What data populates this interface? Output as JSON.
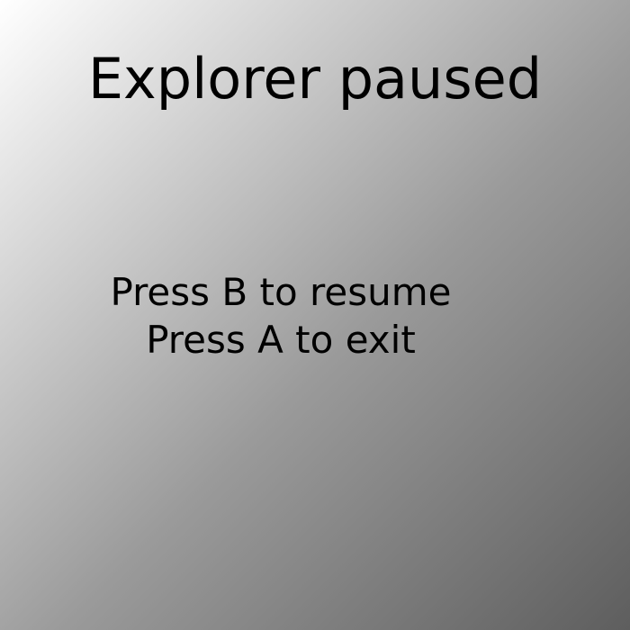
{
  "pause_screen": {
    "title": "Explorer paused",
    "instructions": [
      "Press B to resume",
      "Press A to exit"
    ]
  }
}
